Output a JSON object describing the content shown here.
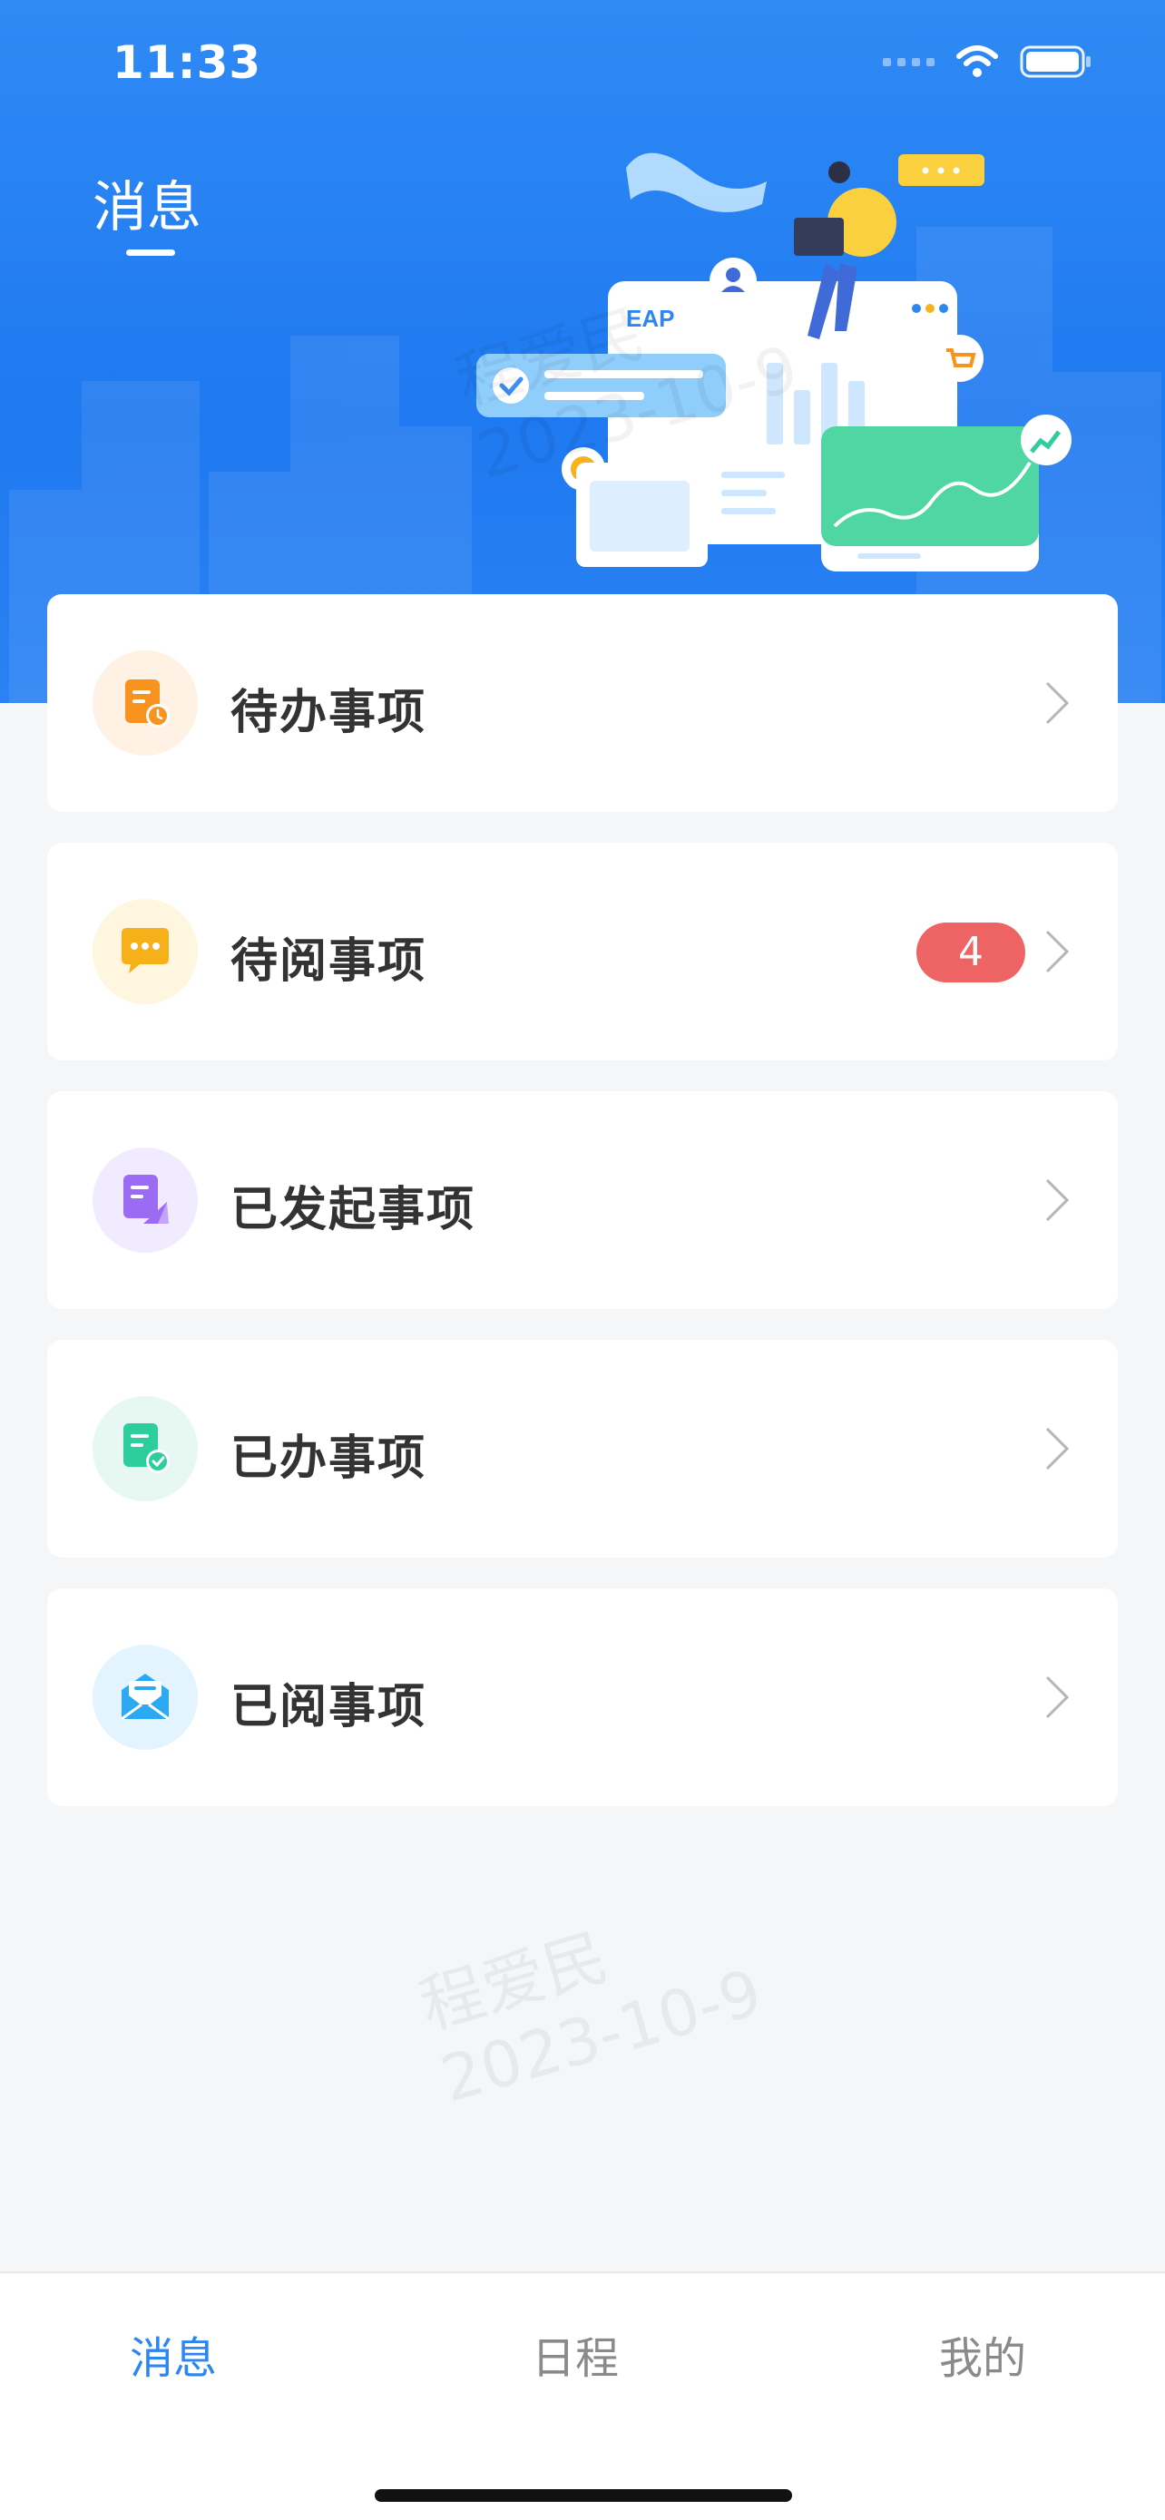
{
  "status_bar": {
    "time": "11:33"
  },
  "header": {
    "title": "消息",
    "illustration_label": "EAP",
    "accent": "#2f8af5"
  },
  "menu": {
    "items": [
      {
        "label": "待办事项",
        "icon": "pending-task-icon",
        "icon_color": "#f7931e",
        "icon_bg": "#fff1e3"
      },
      {
        "label": "待阅事项",
        "icon": "unread-message-icon",
        "icon_color": "#f6b019",
        "icon_bg": "#fff6df",
        "badge": "4"
      },
      {
        "label": "已发起事项",
        "icon": "initiated-icon",
        "icon_color": "#9b6cf3",
        "icon_bg": "#f1ebff"
      },
      {
        "label": "已办事项",
        "icon": "completed-task-icon",
        "icon_color": "#2ccf9c",
        "icon_bg": "#e6f8f1"
      },
      {
        "label": "已阅事项",
        "icon": "read-mail-icon",
        "icon_color": "#2ba9f3",
        "icon_bg": "#e3f4fe"
      }
    ]
  },
  "watermark": {
    "name": "程爱民",
    "date": "2023-10-9"
  },
  "tabbar": {
    "tabs": [
      {
        "label": "消息",
        "active": true
      },
      {
        "label": "日程",
        "active": false
      },
      {
        "label": "我的",
        "active": false
      }
    ]
  }
}
